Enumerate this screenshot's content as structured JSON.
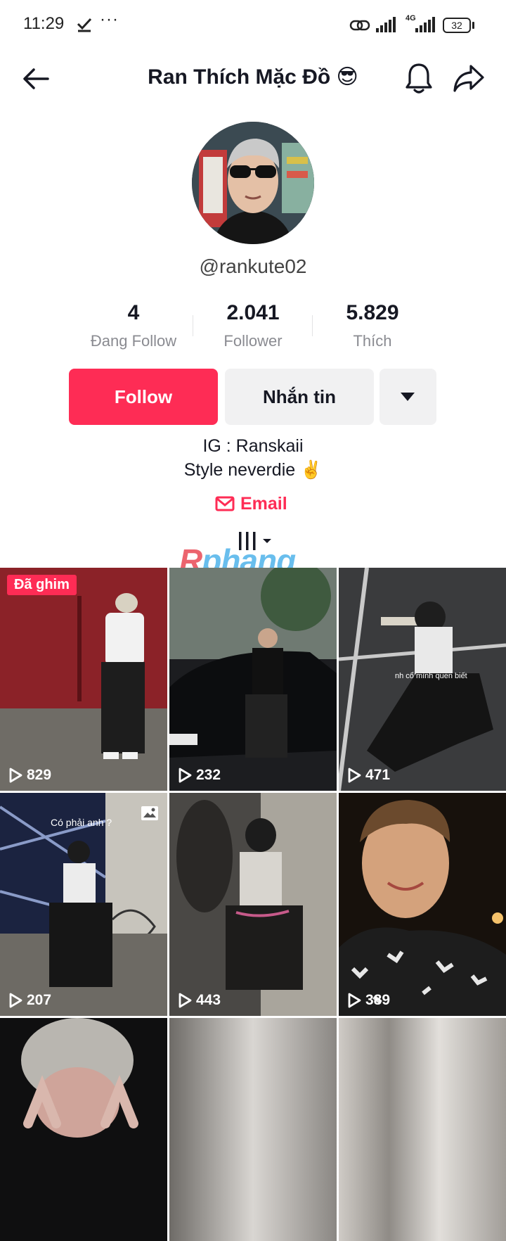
{
  "status_bar": {
    "time": "11:29",
    "battery": "32",
    "network": "4G"
  },
  "header": {
    "title": "Ran Thích Mặc Đồ 😎"
  },
  "profile": {
    "username": "@rankute02",
    "stats": [
      {
        "value": "4",
        "label": "Đang Follow"
      },
      {
        "value": "2.041",
        "label": "Follower"
      },
      {
        "value": "5.829",
        "label": "Thích"
      }
    ],
    "follow_label": "Follow",
    "message_label": "Nhắn tin",
    "bio": [
      "IG : Ranskaii",
      "Style neverdie ✌️"
    ],
    "email_label": "Email"
  },
  "watermark": {
    "prefix": "R",
    "rest": "phang"
  },
  "videos": [
    {
      "views": "829",
      "pinned_label": "Đã ghim"
    },
    {
      "views": "232"
    },
    {
      "views": "471",
      "caption": "nh cổ mình quen biết"
    },
    {
      "views": "207",
      "caption": "Có phải anh ?"
    },
    {
      "views": "443"
    },
    {
      "views": "389"
    },
    {
      "views": ""
    },
    {
      "views": ""
    },
    {
      "views": ""
    }
  ],
  "colors": {
    "accent": "#fe2c55",
    "button_secondary": "#f1f1f2",
    "text_primary": "#161823",
    "text_secondary": "#8a8b91"
  },
  "icons": [
    "back-arrow-icon",
    "bell-icon",
    "share-icon",
    "caret-down-icon",
    "mail-icon",
    "grid-tab-icon",
    "play-icon",
    "photo-icon"
  ]
}
